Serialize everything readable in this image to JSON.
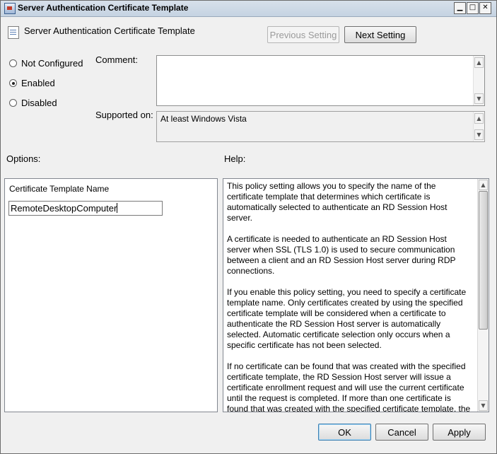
{
  "window": {
    "title": "Server Authentication Certificate Template",
    "setting_name": "Server Authentication Certificate Template",
    "minimize_glyph": "▁",
    "maximize_glyph": "□",
    "close_glyph": "✕"
  },
  "nav": {
    "previous_label": "Previous Setting",
    "next_label": "Next Setting"
  },
  "state": {
    "options": [
      {
        "label": "Not Configured",
        "checked": false
      },
      {
        "label": "Enabled",
        "checked": true
      },
      {
        "label": "Disabled",
        "checked": false
      }
    ]
  },
  "comment": {
    "label": "Comment:",
    "value": ""
  },
  "supported": {
    "label": "Supported on:",
    "value": "At least Windows Vista"
  },
  "options_section": {
    "label": "Options:",
    "field_label": "Certificate Template Name",
    "field_value": "RemoteDesktopComputer"
  },
  "help_section": {
    "label": "Help:",
    "paragraphs": [
      "This policy setting allows you to specify the name of the certificate template that determines which certificate is automatically selected to authenticate an RD Session Host server.",
      "A certificate is needed to authenticate an RD Session Host server when SSL (TLS 1.0) is used to secure communication between a client and an RD Session Host server during RDP connections.",
      "If you enable this policy setting, you need to specify a certificate template name. Only certificates created by using the specified certificate template will be considered when a certificate to authenticate the RD Session Host server is automatically selected. Automatic certificate selection only occurs when a specific certificate has not been selected.",
      "If no certificate can be found that was created with the specified certificate template, the RD Session Host server will issue a certificate enrollment request and will use the current certificate until the request is completed. If more than one certificate is found that was created with the specified certificate template, the certificate that will expire latest and that matches the current"
    ],
    "scroll_fraction": 0.0
  },
  "footer": {
    "ok_label": "OK",
    "cancel_label": "Cancel",
    "apply_label": "Apply"
  },
  "scroll_glyphs": {
    "up": "▲",
    "down": "▼"
  }
}
